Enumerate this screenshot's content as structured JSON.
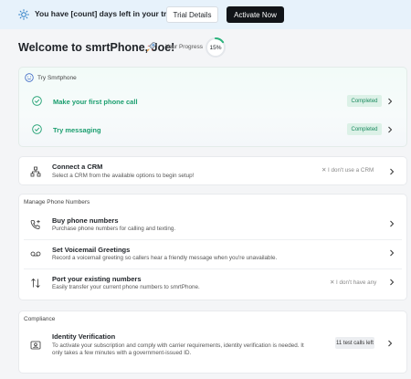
{
  "banner": {
    "message": "You have [count] days left in your trial!",
    "trial_details_label": "Trial Details",
    "activate_label": "Activate Now"
  },
  "header": {
    "welcome": "Welcome to smrtPhone, Joe!",
    "progress_label": "Your Progress",
    "progress_value": "15%",
    "progress_fraction": 0.15
  },
  "try_section": {
    "title": "Try Smrtphone",
    "items": [
      {
        "label": "Make your first phone call",
        "status": "Completed"
      },
      {
        "label": "Try messaging",
        "status": "Completed"
      }
    ]
  },
  "crm": {
    "title": "Connect a CRM",
    "subtitle": "Select a CRM from the available options to begin setup!",
    "skip_label": "I don't use a CRM"
  },
  "numbers_section": {
    "title": "Manage Phone Numbers",
    "items": [
      {
        "title": "Buy phone numbers",
        "subtitle": "Purchase phone numbers for calling and texting."
      },
      {
        "title": "Set Voicemail Greetings",
        "subtitle": "Record a voicemail greeting so callers hear a friendly message when you're unavailable."
      },
      {
        "title": "Port your existing numbers",
        "subtitle": "Easily transfer your current phone numbers to smrtPhone.",
        "skip_label": "I don't have any"
      }
    ]
  },
  "compliance": {
    "title": "Compliance",
    "item_title": "Identity Verification",
    "item_sub_line1": "To activate your subscription and comply with carrier requirements, identity verification is needed. It",
    "item_sub_line2": "only takes a few minutes with a government-issued ID.",
    "badge": "11 test calls left"
  },
  "colors": {
    "accent_green": "#1a9e6e",
    "banner_bg": "#e7f2fb",
    "activate_bg": "#111418"
  }
}
